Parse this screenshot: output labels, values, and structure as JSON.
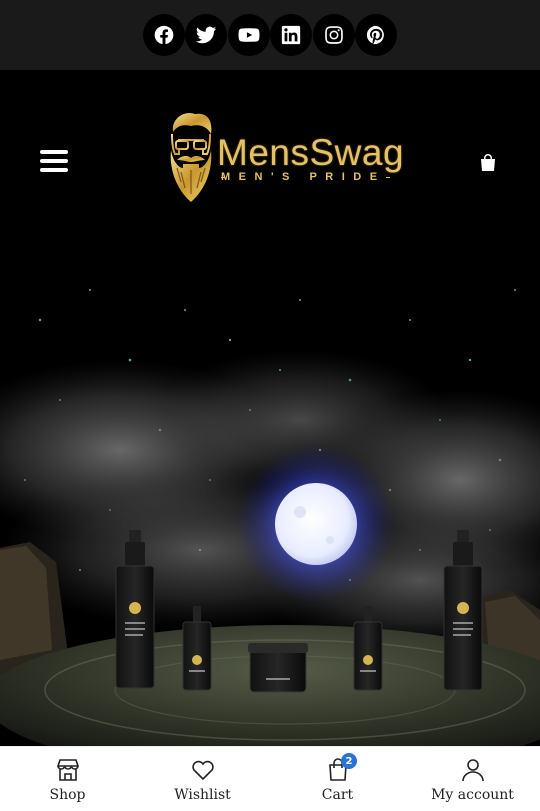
{
  "social": [
    {
      "name": "facebook"
    },
    {
      "name": "twitter"
    },
    {
      "name": "youtube"
    },
    {
      "name": "linkedin"
    },
    {
      "name": "instagram"
    },
    {
      "name": "pinterest"
    }
  ],
  "header": {
    "logo_name": "MensSwag",
    "logo_tagline": "MEN'S PRIDE",
    "menu_icon": "hamburger-menu-icon",
    "cart_icon": "shopping-bag-icon"
  },
  "hero": {
    "scene": "night sky with moon and grooming products",
    "moon_color": "#eef2ff"
  },
  "bottom_nav": {
    "shop": "Shop",
    "wishlist": "Wishlist",
    "cart": "Cart",
    "cart_count": "2",
    "account": "My account"
  },
  "colors": {
    "gold": "#e4c066",
    "badge": "#2a72d6",
    "top_bar": "#1a1a1a"
  }
}
